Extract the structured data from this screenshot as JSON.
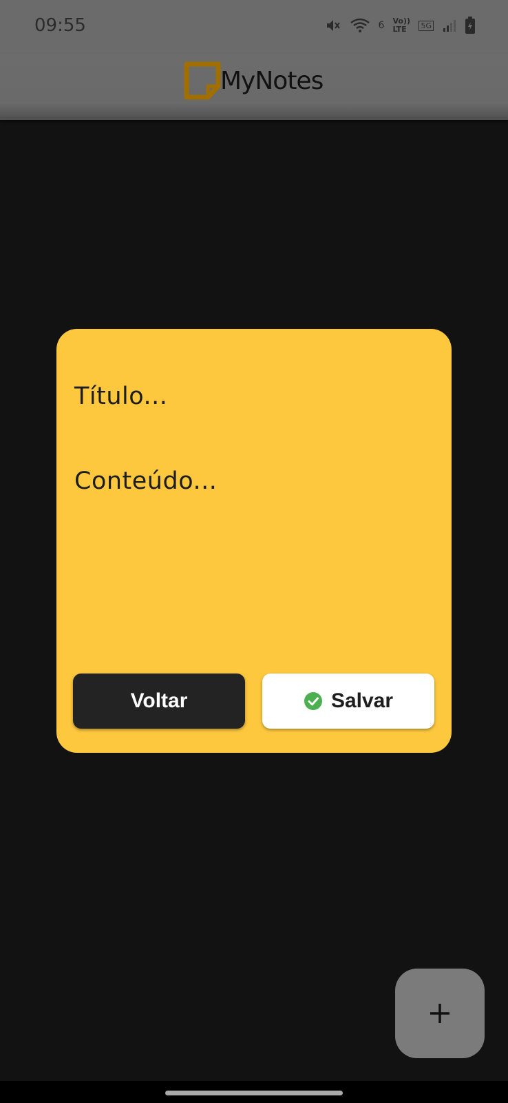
{
  "status_bar": {
    "time": "09:55",
    "network_labels": [
      "6",
      "Vo)) LTE",
      "5G"
    ],
    "icons": [
      "mute-icon",
      "wifi-icon",
      "signal-icon",
      "battery-icon"
    ]
  },
  "app_bar": {
    "app_name": "MyNotes",
    "logo_color": "#a06f00"
  },
  "note_dialog": {
    "title_placeholder": "Título...",
    "content_placeholder": "Conteúdo...",
    "back_label": "Voltar",
    "save_label": "Salvar",
    "card_color": "#fdc83e"
  },
  "fab": {
    "icon": "plus-icon",
    "label": "+"
  }
}
